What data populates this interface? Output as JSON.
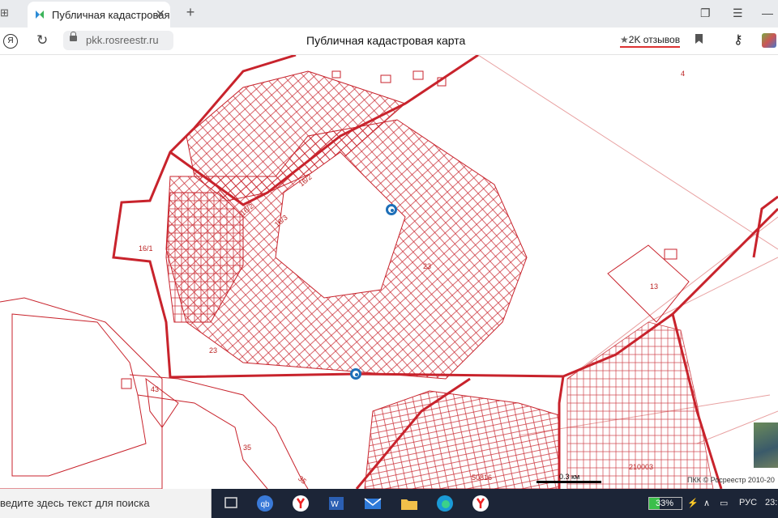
{
  "browser": {
    "tab_title": "Публичная кадастровая",
    "tab_close": "✕",
    "new_tab": "+",
    "url": "pkk.rosreestr.ru",
    "page_title": "Публичная кадастровая карта",
    "reviews": "2K отзывов",
    "yandex_glyph": "Я"
  },
  "map": {
    "labels": [
      {
        "text": "16/2",
        "name": "parcel-label-16-2-a"
      },
      {
        "text": "16/2",
        "name": "parcel-label-16-2-b"
      },
      {
        "text": "16/3",
        "name": "parcel-label-16-3"
      },
      {
        "text": "16/1",
        "name": "parcel-label-16-1"
      },
      {
        "text": "23",
        "name": "parcel-label-23-center"
      },
      {
        "text": "23",
        "name": "parcel-label-23-left"
      },
      {
        "text": "43",
        "name": "parcel-label-43"
      },
      {
        "text": "35",
        "name": "parcel-label-35-a"
      },
      {
        "text": "35",
        "name": "parcel-label-35-b"
      },
      {
        "text": "13",
        "name": "parcel-label-13"
      },
      {
        "text": "4",
        "name": "parcel-label-4"
      },
      {
        "text": "50816",
        "name": "parcel-label-50816"
      },
      {
        "text": "210003",
        "name": "parcel-label-210003"
      }
    ],
    "scale": "0.3 км",
    "copyright": "ПКК © Росреестр 2010-20"
  },
  "taskbar": {
    "search_placeholder": "ведите здесь текст для поиска",
    "battery": "33%",
    "battery_level": 0.33,
    "lang": "РУС",
    "time": "23:"
  },
  "colors": {
    "parcel_line": "#c8232c",
    "marker": "#1e6fb8",
    "taskbar": "#1c2537"
  }
}
